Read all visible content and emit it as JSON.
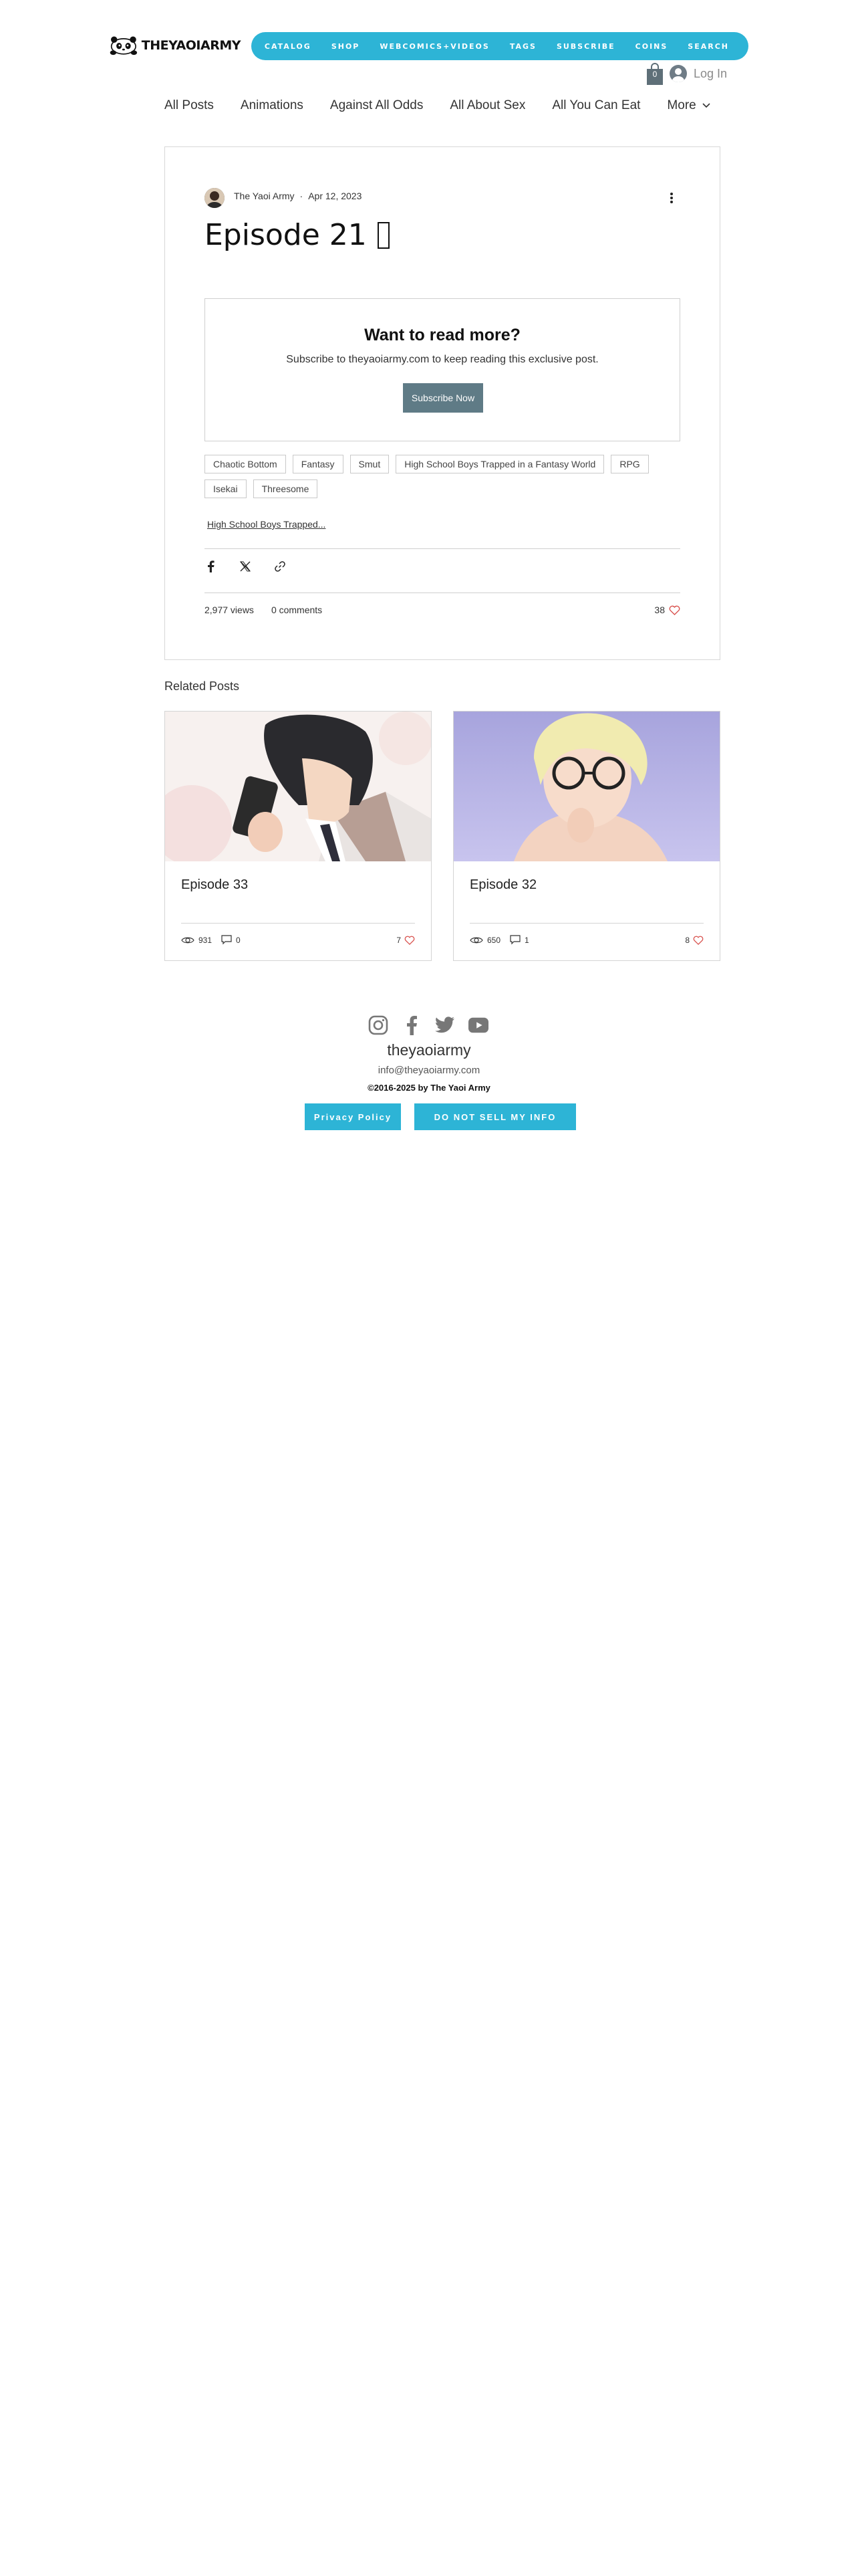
{
  "brand": {
    "logo_text": "THEYAOIARMY"
  },
  "nav": {
    "items": [
      "CATALOG",
      "SHOP",
      "WEBCOMICS+VIDEOS",
      "TAGS",
      "SUBSCRIBE",
      "COINS",
      "SEARCH"
    ],
    "color": "#2db4d6"
  },
  "cart": {
    "count": "0"
  },
  "login": {
    "label": "Log In"
  },
  "categories": [
    "All Posts",
    "Animations",
    "Against All Odds",
    "All About Sex",
    "All You Can Eat"
  ],
  "categories_more": "More",
  "post": {
    "author": "The Yaoi Army",
    "separator": "·",
    "date": "Apr 12, 2023",
    "title": "Episode 21",
    "paywall": {
      "heading": "Want to read more?",
      "text": "Subscribe to theyaoiarmy.com to keep reading this exclusive post.",
      "button": "Subscribe Now",
      "button_color": "#5f7b86"
    },
    "tags": [
      "Chaotic Bottom",
      "Fantasy",
      "Smut",
      "High School Boys Trapped in a Fantasy World",
      "RPG",
      "Isekai",
      "Threesome"
    ],
    "series_link": "High School Boys Trapped...",
    "views": "2,977 views",
    "comments": "0 comments",
    "likes": "38"
  },
  "related": {
    "heading": "Related Posts",
    "posts": [
      {
        "title": "Episode 33",
        "views": "931",
        "comments": "0",
        "likes": "7"
      },
      {
        "title": "Episode 32",
        "views": "650",
        "comments": "1",
        "likes": "8"
      }
    ]
  },
  "footer": {
    "social_icons": [
      "instagram-icon",
      "facebook-icon",
      "twitter-icon",
      "youtube-icon"
    ],
    "site_name": "theyaoiarmy",
    "email": "info@theyaoiarmy.com",
    "copyright": "©2016-2025 by The Yaoi Army",
    "privacy": "Privacy Policy",
    "do_not_sell": "DO NOT SELL MY INFO"
  }
}
